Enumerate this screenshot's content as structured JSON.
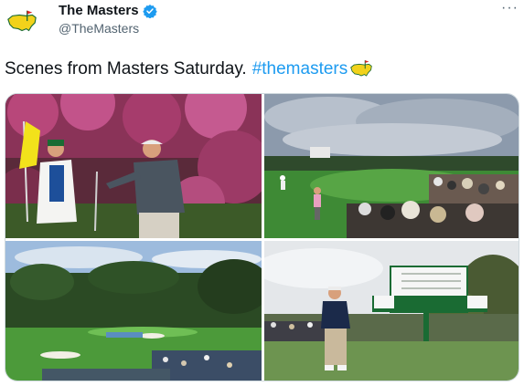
{
  "author": {
    "display_name": "The Masters",
    "handle": "@TheMasters",
    "verified": true,
    "avatar_icon": "masters-logo-icon"
  },
  "tweet": {
    "text": "Scenes from Masters Saturday.",
    "hashtag": "#themasters",
    "hashtag_emoji_icon": "masters-logo-icon",
    "more_label": "···"
  },
  "media": [
    {
      "name": "photo-caddie-and-golfer-handshake",
      "icon": "photo"
    },
    {
      "name": "photo-green-with-gallery",
      "icon": "photo"
    },
    {
      "name": "photo-amen-corner-aerial",
      "icon": "photo"
    },
    {
      "name": "photo-golfer-walking-leaderboard",
      "icon": "photo"
    }
  ],
  "colors": {
    "link": "#1d9bf0",
    "text": "#0f1419",
    "secondary": "#536471",
    "verified": "#1d9bf0",
    "masters_yellow": "#f2d21b",
    "masters_green": "#1a6b33"
  }
}
